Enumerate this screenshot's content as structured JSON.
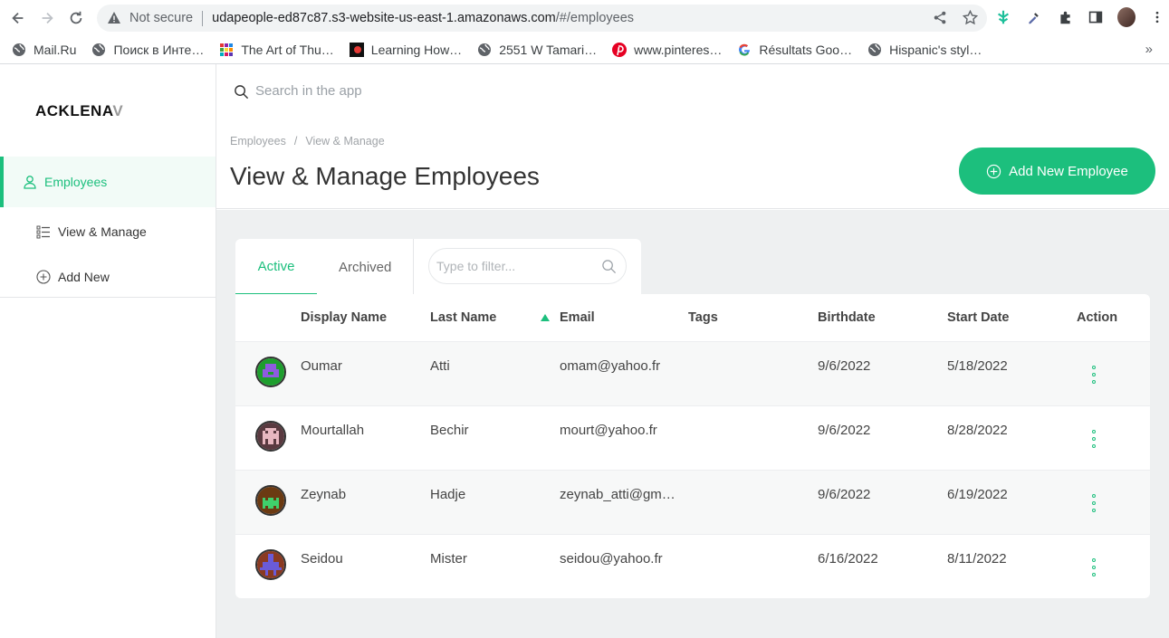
{
  "browser": {
    "security_text": "Not secure",
    "url_host": "udapeople-ed87c87.s3-website-us-east-1.amazonaws.com",
    "url_path": "/#/employees",
    "bookmarks": [
      {
        "label": "Mail.Ru",
        "icon": "globe-icon"
      },
      {
        "label": "Поиск в Инте…",
        "icon": "globe-icon"
      },
      {
        "label": "The Art of Thu…",
        "icon": "grid-icon"
      },
      {
        "label": "Learning How…",
        "icon": "cb-icon"
      },
      {
        "label": "2551 W Tamari…",
        "icon": "globe-icon"
      },
      {
        "label": "www.pinteres…",
        "icon": "pinterest-icon"
      },
      {
        "label": "Résultats Goo…",
        "icon": "google-icon"
      },
      {
        "label": "Hispanic's styl…",
        "icon": "globe-icon"
      }
    ],
    "bookmarks_more": "»"
  },
  "app": {
    "logo_main": "ACKLENA",
    "logo_fade": "V",
    "search_placeholder": "Search in the app",
    "sidebar": {
      "employees": "Employees",
      "view_manage": "View & Manage",
      "add_new": "Add New"
    },
    "breadcrumb": {
      "root": "Employees",
      "sep": "/",
      "current": "View & Manage"
    },
    "page_title": "View & Manage Employees",
    "add_button": "Add New Employee",
    "tabs": {
      "active": "Active",
      "archived": "Archived"
    },
    "filter_placeholder": "Type to filter...",
    "columns": {
      "display_name": "Display Name",
      "last_name": "Last Name",
      "email": "Email",
      "tags": "Tags",
      "birthdate": "Birthdate",
      "start_date": "Start Date",
      "action": "Action"
    },
    "rows": [
      {
        "display_name": "Oumar",
        "last_name": "Atti",
        "email": "omam@yahoo.fr",
        "tags": "",
        "birthdate": "9/6/2022",
        "start_date": "5/18/2022",
        "avatar_bg": "#1e9e2e",
        "avatar_fg": "#8e5be0"
      },
      {
        "display_name": "Mourtallah",
        "last_name": "Bechir",
        "email": "mourt@yahoo.fr",
        "tags": "",
        "birthdate": "9/6/2022",
        "start_date": "8/28/2022",
        "avatar_bg": "#5a3a40",
        "avatar_fg": "#e8b8c0"
      },
      {
        "display_name": "Zeynab",
        "last_name": "Hadje",
        "email": "zeynab_atti@gma…",
        "tags": "",
        "birthdate": "9/6/2022",
        "start_date": "6/19/2022",
        "avatar_bg": "#6b3a12",
        "avatar_fg": "#3fd06b"
      },
      {
        "display_name": "Seidou",
        "last_name": "Mister",
        "email": "seidou@yahoo.fr",
        "tags": "",
        "birthdate": "6/16/2022",
        "start_date": "8/11/2022",
        "avatar_bg": "#8a3a22",
        "avatar_fg": "#6a5bd8"
      }
    ],
    "accent_color": "#1cbf7d"
  }
}
